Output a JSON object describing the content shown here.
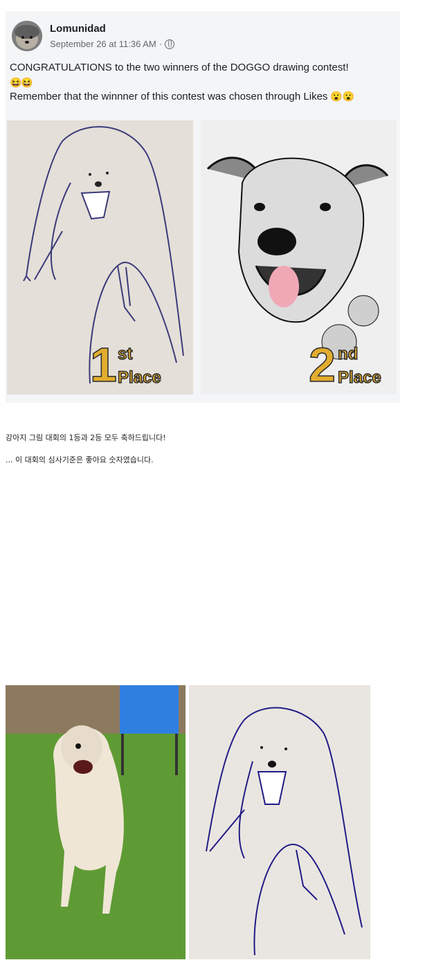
{
  "post": {
    "author": "Lomunidad",
    "timestamp": "September 26 at 11:36 AM",
    "privacy_icon": "globe-icon",
    "line1": "CONGRATULATIONS to the two winners of the DOGGO drawing contest!",
    "emoji_row": "😆😆",
    "line2": "Remember that the winnner of this contest was chosen through Likes",
    "line2_emoji": "😮😮"
  },
  "images": {
    "first": {
      "num": "1",
      "suffix": "st",
      "word": "Place"
    },
    "second": {
      "num": "2",
      "suffix": "nd",
      "word": "Place"
    }
  },
  "caption": {
    "line1": "강아지 그림 대회의 1등과 2등 모두 축하드립니다!",
    "line2": "... 이 대회의 심사기준은 좋아요 숫자였습니다."
  },
  "colors": {
    "place_gold": "#e2ad2f",
    "meta_gray": "#65676b"
  }
}
